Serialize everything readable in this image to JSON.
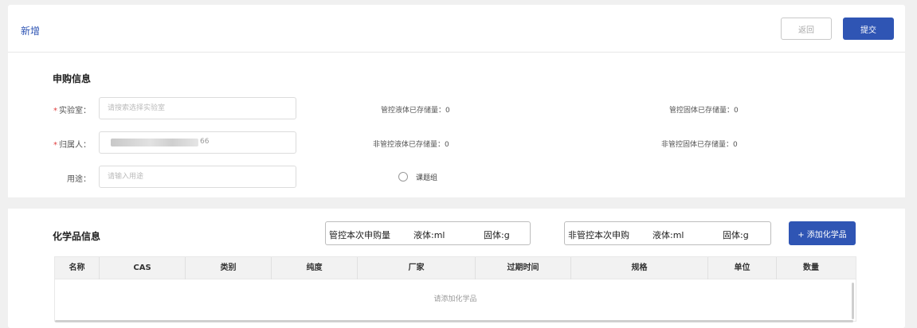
{
  "header": {
    "title": "新增",
    "back_label": "返回",
    "submit_label": "提交"
  },
  "purchase_info": {
    "section_title": "申购信息",
    "lab": {
      "label": "实验室：",
      "placeholder": "请搜索选择实验室"
    },
    "owner": {
      "label": "归属人：",
      "value_tail": "66"
    },
    "usage": {
      "label": "用途：",
      "placeholder": "请输入用途"
    },
    "required_mark": "*",
    "stats": {
      "ctrl_liquid": "管控液体已存储量：0",
      "ctrl_solid": "管控固体已存储量：0",
      "nonctrl_liquid": "非管控液体已存储量：0",
      "nonctrl_solid": "非管控固体已存储量：0"
    },
    "radio_label": "课题组"
  },
  "chem_info": {
    "section_title": "化学品信息",
    "controlled_box": {
      "label": "管控本次申购量",
      "liquid": "液体:ml",
      "solid": "固体:g"
    },
    "noncontrolled_box": {
      "label": "非管控本次申购",
      "liquid": "液体:ml",
      "solid": "固体:g"
    },
    "add_label": "+ 添加化学品",
    "columns": [
      "名称",
      "CAS",
      "类别",
      "纯度",
      "厂家",
      "过期时间",
      "规格",
      "单位",
      "数量"
    ],
    "empty_text": "请添加化学品"
  }
}
